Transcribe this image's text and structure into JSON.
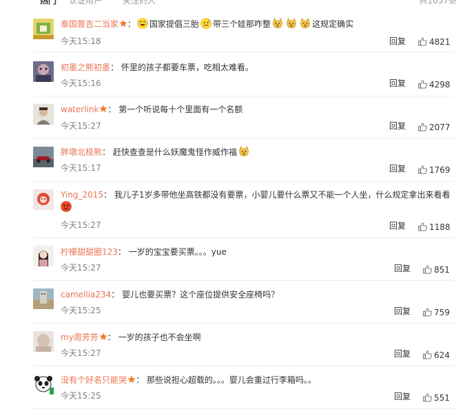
{
  "tabs": {
    "hot": "热门",
    "verified": "认证用户",
    "following": "关注的人"
  },
  "total_count": "共1057条",
  "colors": {
    "username": "#eb7350",
    "badge": "#f5772d",
    "time": "#808080",
    "divider": "#eeeeee"
  },
  "reply_label": "回复",
  "comments": [
    {
      "user": "泰国普吉二当家",
      "verified": true,
      "segments": [
        "",
        "国家提倡三胎",
        "带三个娃那咋整",
        "",
        "",
        "这规定确实"
      ],
      "emojis": [
        "laugh-emoji",
        "sweat-emoji",
        "doge-emoji",
        "doge-emoji",
        "doge-emoji"
      ],
      "time": "今天15:18",
      "likes": "4821"
    },
    {
      "user": "初墨之熊初墨",
      "verified": false,
      "text": "怀里的孩子都要车票，吃相太难看。",
      "time": "今天15:16",
      "likes": "4298"
    },
    {
      "user": "waterlink",
      "verified": true,
      "text": "第一个听说每十个里面有一个名额",
      "time": "今天15:27",
      "likes": "2077"
    },
    {
      "user": "胖墩北极熊",
      "verified": false,
      "text": "赶快查查是什么妖魔鬼怪作威作福",
      "emojis": [
        "doge-emoji"
      ],
      "time": "今天15:17",
      "likes": "1769"
    },
    {
      "user": "Ying_2015",
      "verified": false,
      "text": "我儿子1岁多带他坐高铁都没有要票，小婴儿要什么票又不能一个人坐，什么规定拿出来看看",
      "emojis": [
        "angry-emoji"
      ],
      "time": "今天15:27",
      "likes": "1188"
    },
    {
      "user": "柠檬甜甜圈123",
      "verified": false,
      "text": "一岁的宝宝要买票。。。yue",
      "time": "今天15:27",
      "likes": "851"
    },
    {
      "user": "camellia234",
      "verified": false,
      "text": "婴儿也要买票？这个座位提供安全座椅吗？",
      "time": "今天15:25",
      "likes": "759"
    },
    {
      "user": "my周芳芳",
      "verified": true,
      "text": "一岁的孩子也不会坐啊",
      "time": "今天15:27",
      "likes": "624"
    },
    {
      "user": "没有个好名只能哭",
      "verified": true,
      "text": "那些说担心超载的。。。婴儿会重过行李箱吗。。",
      "time": "今天15:25",
      "likes": "551"
    }
  ]
}
